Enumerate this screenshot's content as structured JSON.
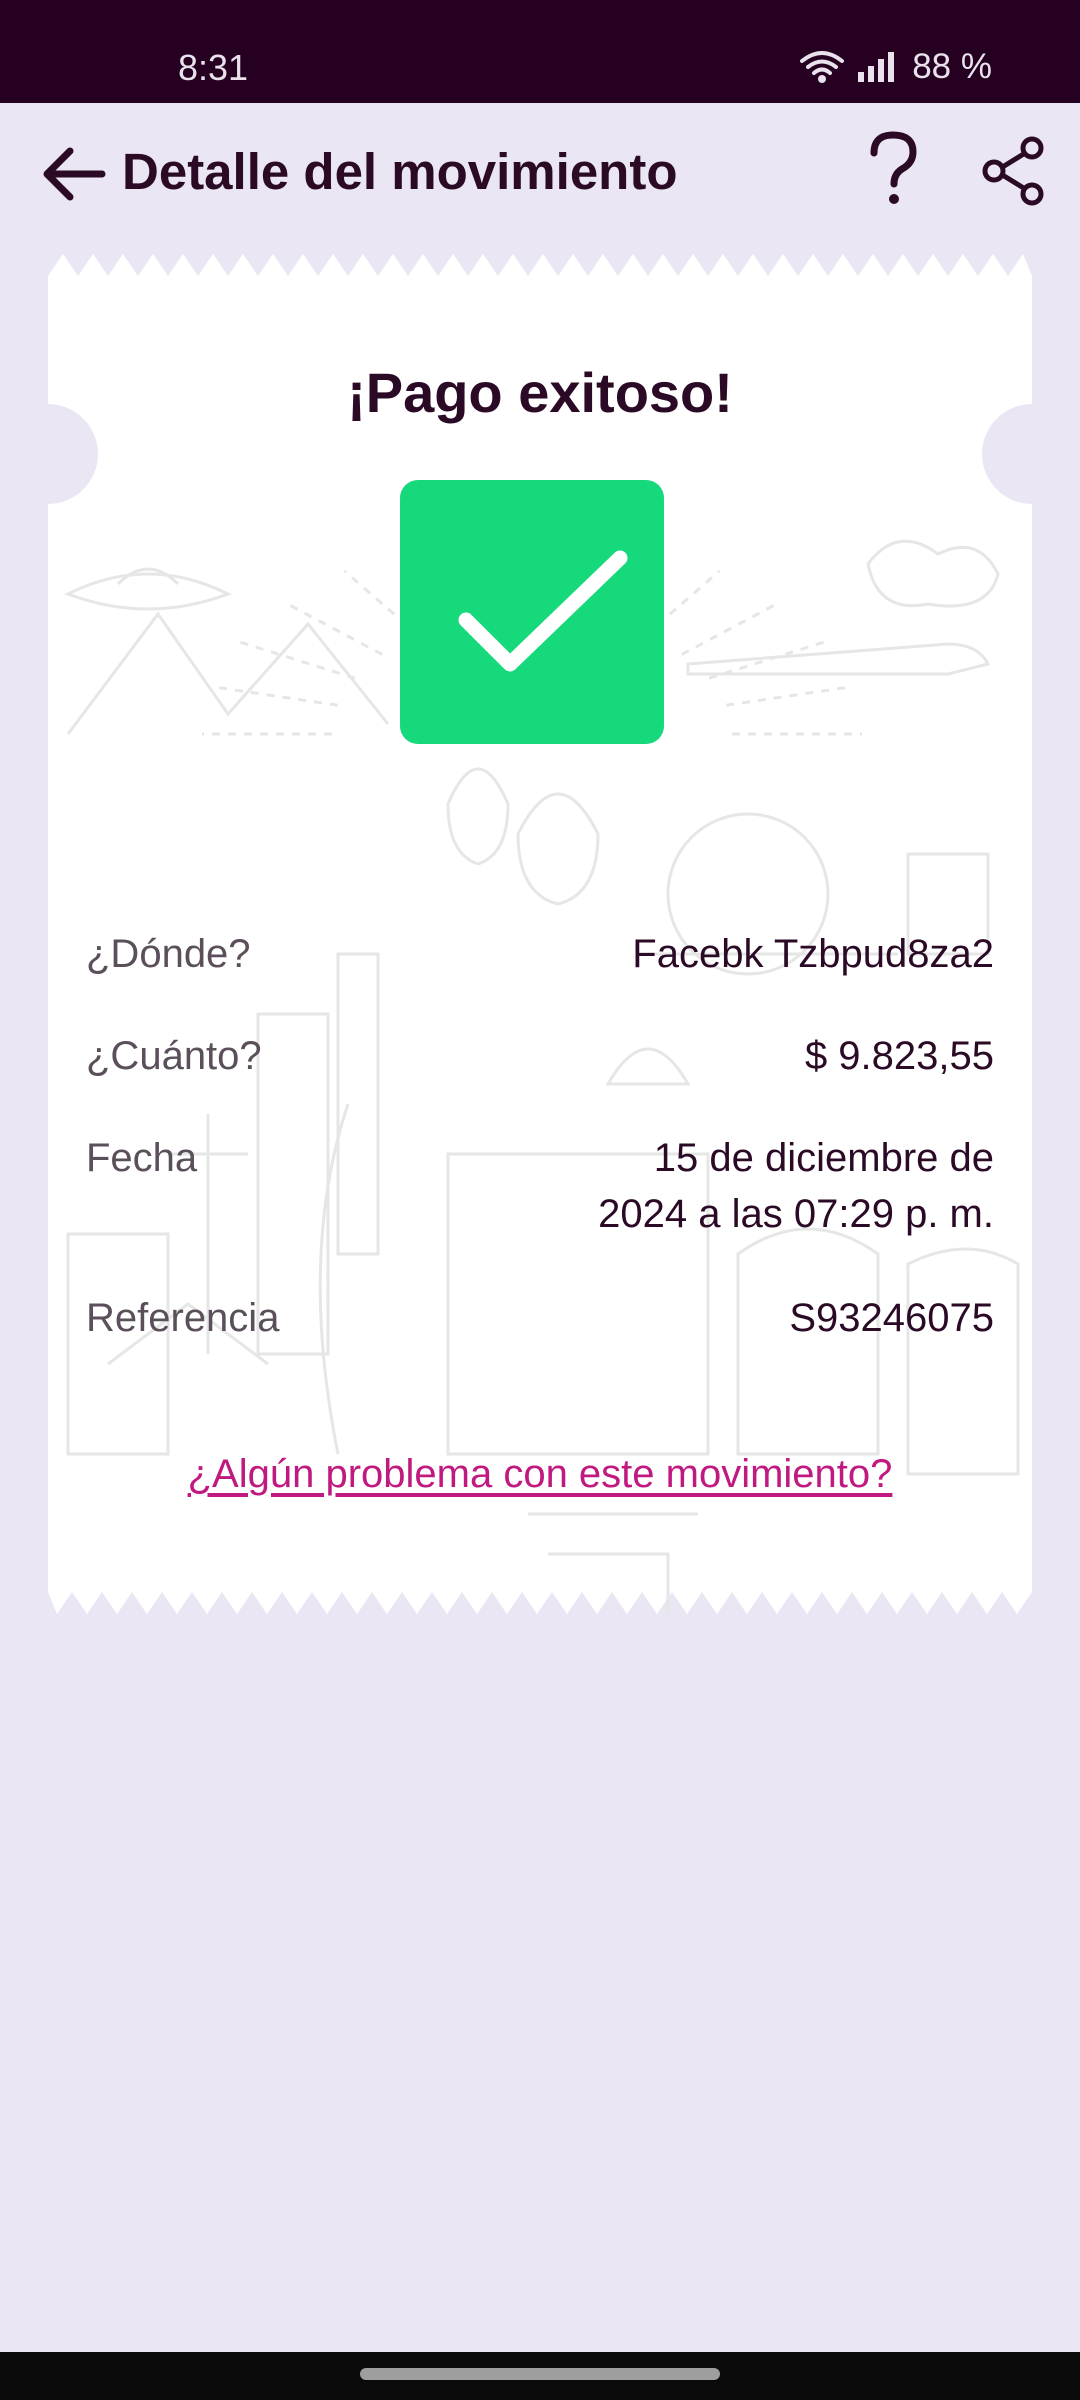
{
  "status_bar": {
    "time": "8:31",
    "battery": "88 %",
    "icons": [
      "wifi-icon",
      "signal-icon"
    ]
  },
  "header": {
    "title": "Detalle del movimiento",
    "icons": [
      "arrow-back-icon",
      "help-icon",
      "share-icon"
    ]
  },
  "receipt": {
    "title": "¡Pago exitoso!",
    "status_icon": "check-icon",
    "rows": [
      {
        "label": "¿Dónde?",
        "value": "Facebk Tzbpud8za2"
      },
      {
        "label": "¿Cuánto?",
        "value": "$ 9.823,55"
      },
      {
        "label": "Fecha",
        "value_line1": "15 de diciembre de",
        "value_line2": "2024 a las 07:29 p. m."
      },
      {
        "label": "Referencia",
        "value": "S93246075"
      }
    ],
    "problem_link": "¿Algún problema con este movimiento?"
  },
  "colors": {
    "background": "#EAE6F4",
    "status_bar": "#250021",
    "text_dark": "#2B0A26",
    "success_green": "#15D97A",
    "link_magenta": "#C0197F"
  }
}
